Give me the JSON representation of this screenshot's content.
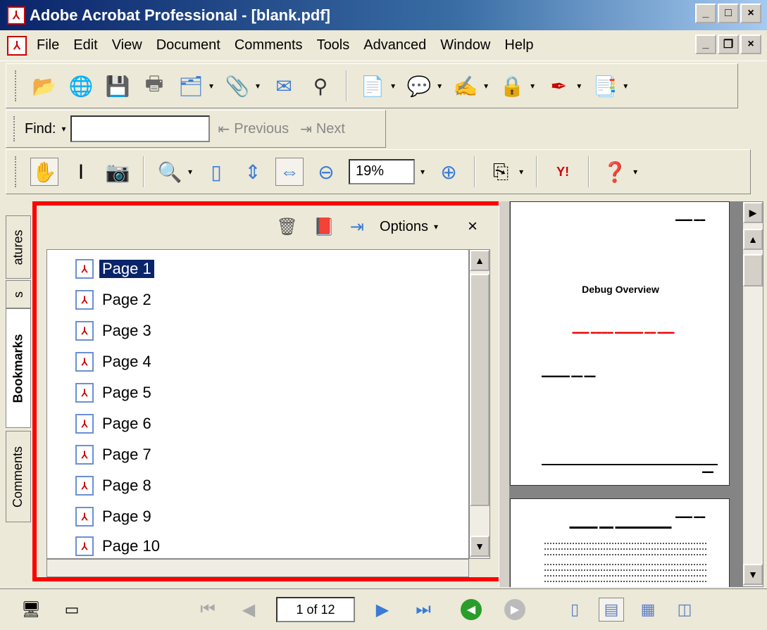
{
  "window": {
    "title": "Adobe Acrobat Professional - [blank.pdf]",
    "controls": [
      "_",
      "□",
      "×"
    ]
  },
  "menubar": {
    "items": [
      "File",
      "Edit",
      "View",
      "Document",
      "Comments",
      "Tools",
      "Advanced",
      "Window",
      "Help"
    ],
    "doc_controls": [
      "_",
      "❐",
      "×"
    ]
  },
  "toolbar": {
    "icons": [
      "open-folder-icon",
      "browse-icon",
      "save-icon",
      "print-icon",
      "organizer-icon",
      "attach-icon",
      "email-icon",
      "search-binoculars-icon",
      "create-pdf-icon",
      "comment-icon",
      "sign-icon",
      "secure-icon",
      "pen-icon",
      "forms-icon"
    ]
  },
  "find": {
    "label": "Find:",
    "value": "",
    "previous": "Previous",
    "next": "Next"
  },
  "zoom": {
    "value": "19%"
  },
  "nav_tabs": {
    "signatures": "atures",
    "layers": "s",
    "bookmarks": "Bookmarks",
    "comments": "Comments"
  },
  "bookmarks_panel": {
    "options_label": "Options",
    "close_label": "×",
    "items": [
      "Page 1",
      "Page 2",
      "Page 3",
      "Page 4",
      "Page 5",
      "Page 6",
      "Page 7",
      "Page 8",
      "Page 9",
      "Page 10"
    ],
    "selected_index": 0
  },
  "document": {
    "page1_heading": "Debug Overview"
  },
  "statusbar": {
    "page_indicator": "1 of 12"
  }
}
